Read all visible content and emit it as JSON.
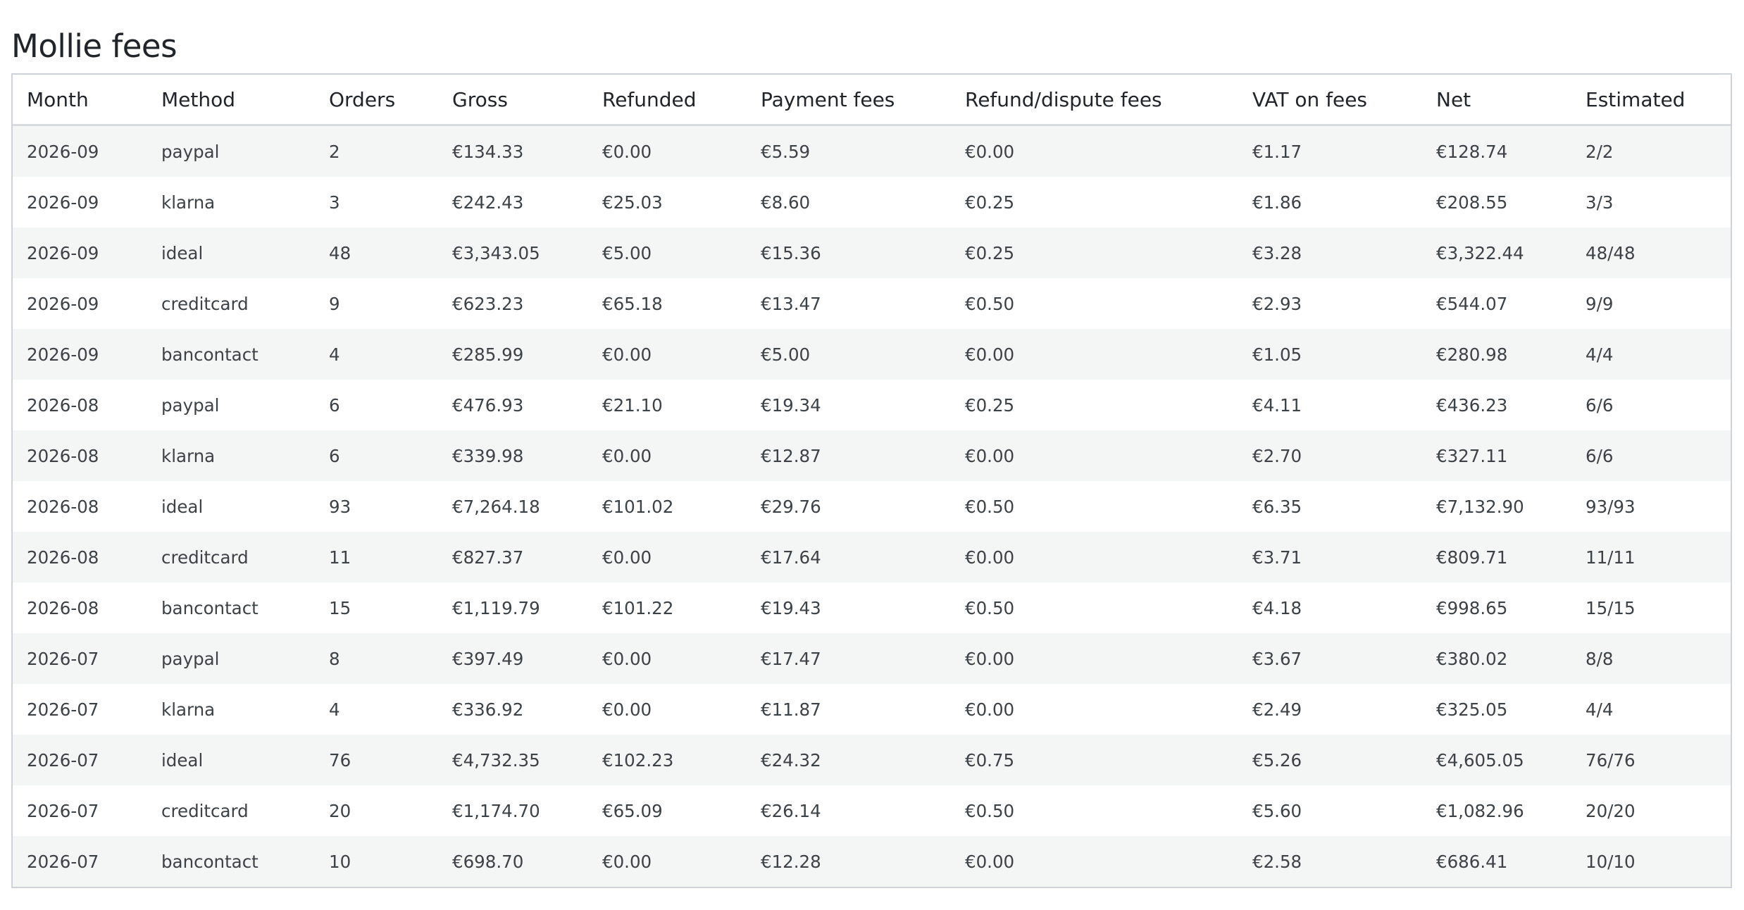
{
  "title": "Mollie fees",
  "table": {
    "headers": [
      "Month",
      "Method",
      "Orders",
      "Gross",
      "Refunded",
      "Payment fees",
      "Refund/dispute fees",
      "VAT on fees",
      "Net",
      "Estimated"
    ],
    "rows": [
      [
        "2026-09",
        "paypal",
        "2",
        "€134.33",
        "€0.00",
        "€5.59",
        "€0.00",
        "€1.17",
        "€128.74",
        "2/2"
      ],
      [
        "2026-09",
        "klarna",
        "3",
        "€242.43",
        "€25.03",
        "€8.60",
        "€0.25",
        "€1.86",
        "€208.55",
        "3/3"
      ],
      [
        "2026-09",
        "ideal",
        "48",
        "€3,343.05",
        "€5.00",
        "€15.36",
        "€0.25",
        "€3.28",
        "€3,322.44",
        "48/48"
      ],
      [
        "2026-09",
        "creditcard",
        "9",
        "€623.23",
        "€65.18",
        "€13.47",
        "€0.50",
        "€2.93",
        "€544.07",
        "9/9"
      ],
      [
        "2026-09",
        "bancontact",
        "4",
        "€285.99",
        "€0.00",
        "€5.00",
        "€0.00",
        "€1.05",
        "€280.98",
        "4/4"
      ],
      [
        "2026-08",
        "paypal",
        "6",
        "€476.93",
        "€21.10",
        "€19.34",
        "€0.25",
        "€4.11",
        "€436.23",
        "6/6"
      ],
      [
        "2026-08",
        "klarna",
        "6",
        "€339.98",
        "€0.00",
        "€12.87",
        "€0.00",
        "€2.70",
        "€327.11",
        "6/6"
      ],
      [
        "2026-08",
        "ideal",
        "93",
        "€7,264.18",
        "€101.02",
        "€29.76",
        "€0.50",
        "€6.35",
        "€7,132.90",
        "93/93"
      ],
      [
        "2026-08",
        "creditcard",
        "11",
        "€827.37",
        "€0.00",
        "€17.64",
        "€0.00",
        "€3.71",
        "€809.71",
        "11/11"
      ],
      [
        "2026-08",
        "bancontact",
        "15",
        "€1,119.79",
        "€101.22",
        "€19.43",
        "€0.50",
        "€4.18",
        "€998.65",
        "15/15"
      ],
      [
        "2026-07",
        "paypal",
        "8",
        "€397.49",
        "€0.00",
        "€17.47",
        "€0.00",
        "€3.67",
        "€380.02",
        "8/8"
      ],
      [
        "2026-07",
        "klarna",
        "4",
        "€336.92",
        "€0.00",
        "€11.87",
        "€0.00",
        "€2.49",
        "€325.05",
        "4/4"
      ],
      [
        "2026-07",
        "ideal",
        "76",
        "€4,732.35",
        "€102.23",
        "€24.32",
        "€0.75",
        "€5.26",
        "€4,605.05",
        "76/76"
      ],
      [
        "2026-07",
        "creditcard",
        "20",
        "€1,174.70",
        "€65.09",
        "€26.14",
        "€0.50",
        "€5.60",
        "€1,082.96",
        "20/20"
      ],
      [
        "2026-07",
        "bancontact",
        "10",
        "€698.70",
        "€0.00",
        "€12.28",
        "€0.00",
        "€2.58",
        "€686.41",
        "10/10"
      ]
    ]
  }
}
